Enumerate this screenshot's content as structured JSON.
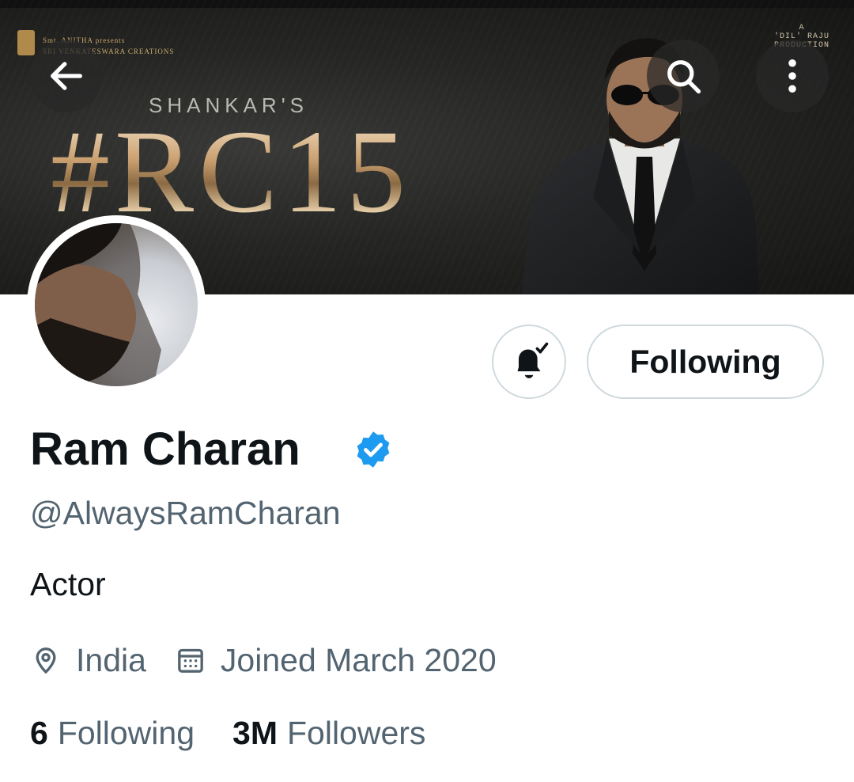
{
  "banner": {
    "presents_line1": "Smt. ANITHA presents",
    "presents_line2": "SRI VENKATESWARA CREATIONS",
    "production_line1": "A",
    "production_line2": "'DIL' RAJU",
    "production_line3": "PRODUCTION",
    "subtitle": "SHANKAR'S",
    "title": "#RC15"
  },
  "icons": {
    "back": "arrow-left-icon",
    "search": "search-icon",
    "more": "more-vertical-icon",
    "bell": "bell-check-icon",
    "verified": "verified-badge-icon",
    "location": "location-pin-icon",
    "calendar": "calendar-icon"
  },
  "profile": {
    "name": "Ram Charan",
    "handle": "@AlwaysRamCharan",
    "bio": "Actor",
    "location": "India",
    "joined": "Joined March 2020",
    "following_count": "6",
    "following_label": "Following",
    "followers_count": "3M",
    "followers_label": "Followers"
  },
  "actions": {
    "follow_button": "Following"
  },
  "colors": {
    "verified_blue": "#1d9bf0",
    "secondary_text": "#536471",
    "primary_text": "#0f1419",
    "border": "#cfd9de"
  }
}
